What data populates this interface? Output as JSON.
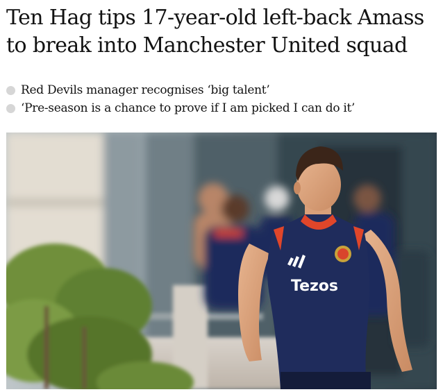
{
  "article": {
    "headline": "Ten Hag tips 17-year-old left-back Amass to break into Manchester United squad",
    "standfirst": [
      "Red Devils manager recognises ‘big talent’",
      "‘Pre-season is a chance to prove if I am picked I can do it’"
    ],
    "photo": {
      "shirt_sponsor": "Tezos",
      "colors": {
        "shirt_navy": "#1f2c5c",
        "shirt_accent": "#e0462a",
        "foliage": "#6f8f3a"
      }
    }
  }
}
